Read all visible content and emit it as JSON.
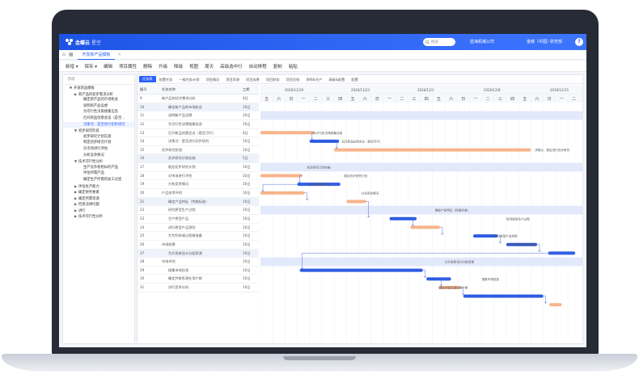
{
  "app": {
    "logo": "金蝶云",
    "logo_sub": "星空",
    "search_placeholder": "搜索",
    "company": "蓝海机械公司",
    "org": "金蝶（中国）",
    "user": "财务部",
    "help": "?"
  },
  "tab": {
    "home_icon": "⌂",
    "grid_icon": "▦",
    "label": "开发新产品模板",
    "close": "✕"
  },
  "menu": [
    "新增 ▾",
    "保存 ▾",
    "编辑",
    "项目属性",
    "删除",
    "升级",
    "降级",
    "视图",
    "周天",
    "高级选中行",
    "自动排程",
    "复制",
    "粘贴"
  ],
  "sidebar": {
    "title": "阶段",
    "items": [
      {
        "label": "开发新品模板",
        "level": 0,
        "arrow": "▼"
      },
      {
        "label": "新产品的初步需求分析",
        "level": 1,
        "arrow": "▶"
      },
      {
        "label": "确定新产品的市场机会",
        "level": 2,
        "arrow": ""
      },
      {
        "label": "说明新产品设想",
        "level": 2,
        "arrow": ""
      },
      {
        "label": "为可行性决策搜集信息",
        "level": 2,
        "arrow": ""
      },
      {
        "label": "召开新品创意会议（是否…",
        "level": 2,
        "arrow": ""
      },
      {
        "label": "决策点：是否进行初步研究",
        "level": 2,
        "arrow": "",
        "selected": true
      },
      {
        "label": "初步研究阶段",
        "level": 1,
        "arrow": "▼"
      },
      {
        "label": "初步研究计划实施",
        "level": 2,
        "arrow": ""
      },
      {
        "label": "制定初步研究计划",
        "level": 2,
        "arrow": ""
      },
      {
        "label": "对市场进行评估",
        "level": 2,
        "arrow": ""
      },
      {
        "label": "分析竞争情况",
        "level": 2,
        "arrow": ""
      },
      {
        "label": "技术可行性分析",
        "level": 1,
        "arrow": "▼"
      },
      {
        "label": "生产竞争者相似的产品",
        "level": 2,
        "arrow": ""
      },
      {
        "label": "评估所需产品",
        "level": 2,
        "arrow": ""
      },
      {
        "label": "确定生产所需的加工过程",
        "level": 2,
        "arrow": ""
      },
      {
        "label": "评估生产能力",
        "level": 1,
        "arrow": "▶"
      },
      {
        "label": "确定财务要素",
        "level": 1,
        "arrow": "▶"
      },
      {
        "label": "确定所需资源",
        "level": 1,
        "arrow": "▶"
      },
      {
        "label": "检查法律问题",
        "level": 1,
        "arrow": "▶"
      },
      {
        "label": "进行",
        "level": 1,
        "arrow": "▶"
      },
      {
        "label": "技术可行性分析",
        "level": 1,
        "arrow": "▶"
      }
    ]
  },
  "subtabs": [
    "任务表",
    "前置任务",
    "一般任务计划",
    "项目概况",
    "项目资源",
    "项目成果",
    "项目财务",
    "项目总结",
    "采购&生产",
    "高级&配置",
    "配置"
  ],
  "grid": {
    "headers": {
      "num": "编号",
      "name": "任务名称",
      "dur": "工期"
    },
    "rows": [
      {
        "num": "9",
        "name": "新产品的初步需求分析",
        "dur": "4日",
        "indent": 0,
        "band": false
      },
      {
        "num": "10",
        "name": "确定新产品的市场机会",
        "dur": "10日",
        "indent": 1,
        "band": true
      },
      {
        "num": "11",
        "name": "说明新产品设想",
        "dur": "10日",
        "indent": 1,
        "band": false
      },
      {
        "num": "12",
        "name": "为可行性决策搜集信息",
        "dur": "20日",
        "indent": 1,
        "band": false
      },
      {
        "num": "13",
        "name": "召开新品创意会议（是否可行）",
        "dur": "4日",
        "indent": 1,
        "band": false
      },
      {
        "num": "14",
        "name": "决策点：是否进行初步研究",
        "dur": "10日",
        "indent": 1,
        "band": false
      },
      {
        "num": "15",
        "name": "初步研究阶段",
        "dur": "10日",
        "indent": 0,
        "band": false
      },
      {
        "num": "16",
        "name": "初步研究计划实施",
        "dur": "5日",
        "indent": 1,
        "band": true
      },
      {
        "num": "17",
        "name": "制定初步研究计划",
        "dur": "10日",
        "indent": 1,
        "band": false
      },
      {
        "num": "18",
        "name": "对市场进行评估",
        "dur": "10日",
        "indent": 1,
        "band": false
      },
      {
        "num": "19",
        "name": "分析竞争情况",
        "dur": "10日",
        "indent": 1,
        "band": false
      },
      {
        "num": "20",
        "name": "产品技术评估",
        "dur": "10日",
        "indent": 0,
        "band": false
      },
      {
        "num": "21",
        "name": "确定产品特征（性能标准）",
        "dur": "10日",
        "indent": 1,
        "band": true
      },
      {
        "num": "22",
        "name": "研究原型生产过程",
        "dur": "10日",
        "indent": 1,
        "band": false
      },
      {
        "num": "23",
        "name": "生产原型产品",
        "dur": "10日",
        "indent": 1,
        "band": false
      },
      {
        "num": "24",
        "name": "进行原型产品测验",
        "dur": "10日",
        "indent": 1,
        "band": false
      },
      {
        "num": "25",
        "name": "为专利申请过程做准备",
        "dur": "10日",
        "indent": 1,
        "band": false
      },
      {
        "num": "26",
        "name": "市场前景",
        "dur": "10日",
        "indent": 0,
        "band": false
      },
      {
        "num": "27",
        "name": "为开发新设计分配资源",
        "dur": "10日",
        "indent": 1,
        "band": true
      },
      {
        "num": "28",
        "name": "市场评估",
        "dur": "10日",
        "indent": 0,
        "band": false
      },
      {
        "num": "29",
        "name": "搜集市场信息",
        "dur": "10日",
        "indent": 1,
        "band": false
      },
      {
        "num": "30",
        "name": "确定并联系潜在用户群",
        "dur": "10日",
        "indent": 1,
        "band": false
      },
      {
        "num": "31",
        "name": "进行竞争分析",
        "dur": "10日",
        "indent": 1,
        "band": false
      }
    ]
  },
  "gantt": {
    "weeks": [
      "2020/11/19",
      "2020/11/23",
      "2020/12/1",
      "2020/12/8",
      "2020/12/15"
    ],
    "days": [
      "五",
      "六",
      "日",
      "一",
      "二",
      "三",
      "四",
      "五",
      "六",
      "日",
      "一",
      "二",
      "三",
      "四",
      "五",
      "六",
      "日",
      "一",
      "二",
      "三",
      "四",
      "五",
      "六",
      "日",
      "一",
      "二"
    ],
    "bar_labels": [
      {
        "text": "为可行性决策搜集信息",
        "row": 3,
        "day": 4.3
      },
      {
        "text": "召开新品创意会议（是否可行）",
        "row": 4,
        "day": 6.6
      },
      {
        "text": "决策点：是否进行初步研究",
        "row": 5,
        "day": 22.3
      },
      {
        "text": "初步研究计划实施",
        "row": 7,
        "day": 3.8
      },
      {
        "text": "制定初步研究计划",
        "row": 8,
        "day": 6.8
      },
      {
        "text": "对市场进行评估",
        "row": 9,
        "day": 4.0
      },
      {
        "text": "分析竞争情况",
        "row": 10,
        "day": 8.2
      },
      {
        "text": "确定产品特征（性能标准）",
        "row": 12,
        "day": 14.2
      },
      {
        "text": "研究原型生产过程",
        "row": 13,
        "day": 20.0
      },
      {
        "text": "进行原型产品测验",
        "row": 15,
        "day": 19.0
      },
      {
        "text": "为专利申请过程做准备",
        "row": 16,
        "day": 20.0
      },
      {
        "text": "为开发新设计分配资源",
        "row": 18,
        "day": 15.0
      },
      {
        "text": "搜集市场信息",
        "row": 20,
        "day": 18.0
      },
      {
        "text": "确定并联系潜在用户群",
        "row": 21,
        "day": 14.5
      }
    ],
    "colors": {
      "blue": "#2d5be3",
      "orange": "#f8b48a",
      "band": "#e2e9fa",
      "line": "#4d6fe0"
    }
  },
  "bars": [
    {
      "row": 3,
      "start": 0.0,
      "len": 4.4,
      "kind": "orange"
    },
    {
      "row": 4,
      "start": 4.0,
      "len": 2.4,
      "kind": "blue"
    },
    {
      "row": 5,
      "start": 6.0,
      "len": 16.0,
      "kind": "orange"
    },
    {
      "row": 8,
      "start": 0.0,
      "len": 3.4,
      "kind": "orange"
    },
    {
      "row": 9,
      "start": 3.0,
      "len": 3.5,
      "kind": "blue"
    },
    {
      "row": 10,
      "start": 0.0,
      "len": 3.6,
      "kind": "orange"
    },
    {
      "row": 11,
      "start": 7.0,
      "len": 1.6,
      "kind": "orange"
    },
    {
      "row": 13,
      "start": 10.5,
      "len": 2.2,
      "kind": "blue"
    },
    {
      "row": 14,
      "start": 12.2,
      "len": 2.4,
      "kind": "orange"
    },
    {
      "row": 15,
      "start": 17.3,
      "len": 2.0,
      "kind": "blue"
    },
    {
      "row": 16,
      "start": 20.0,
      "len": 2.5,
      "kind": "blue"
    },
    {
      "row": 17,
      "start": 23.4,
      "len": 2.2,
      "kind": "blue"
    },
    {
      "row": 19,
      "start": 3.2,
      "len": 10.0,
      "kind": "blue"
    },
    {
      "row": 20,
      "start": 13.5,
      "len": 2.0,
      "kind": "blue"
    },
    {
      "row": 21,
      "start": 14.5,
      "len": 1.8,
      "kind": "orange"
    },
    {
      "row": 22,
      "start": 16.5,
      "len": 6.5,
      "kind": "blue"
    },
    {
      "row": 23,
      "start": 23.5,
      "len": 1.0,
      "kind": "orange"
    }
  ]
}
